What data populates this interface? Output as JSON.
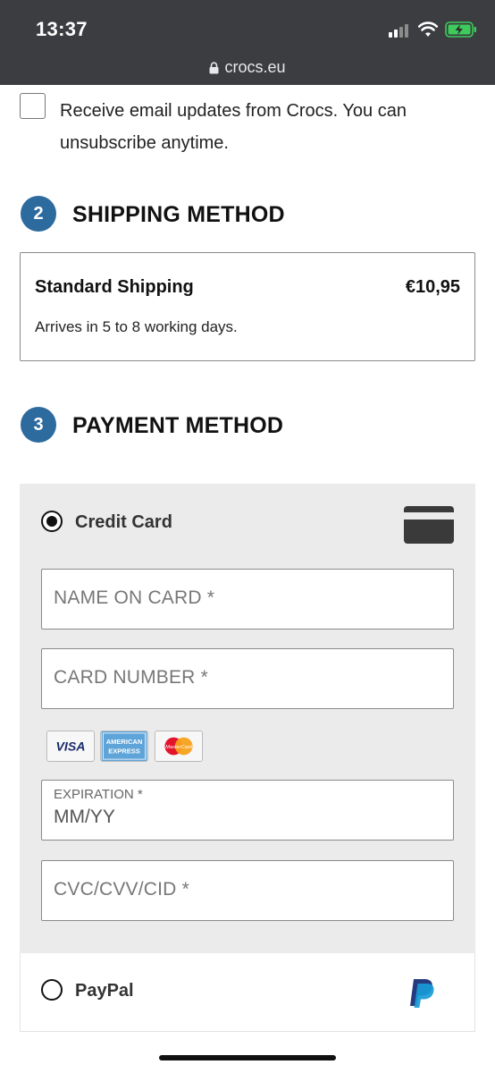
{
  "status_bar": {
    "time": "13:37",
    "icons": [
      "cellular-signal-icon",
      "wifi-icon",
      "battery-charging-icon"
    ],
    "battery_color": "#3ecb5b"
  },
  "browser": {
    "url": "crocs.eu",
    "icon": "lock-icon"
  },
  "newsletter": {
    "label": "Receive email updates from Crocs. You can unsubscribe anytime.",
    "checked": false
  },
  "shipping": {
    "step": "2",
    "title": "SHIPPING METHOD",
    "option": {
      "name": "Standard Shipping",
      "price": "€10,95",
      "eta": "Arrives in 5 to 8 working days."
    }
  },
  "payment": {
    "step": "3",
    "title": "PAYMENT METHOD",
    "credit_card": {
      "label": "Credit Card",
      "selected": true,
      "icon": "credit-card-icon",
      "name_placeholder": "NAME ON CARD *",
      "number_placeholder": "CARD NUMBER *",
      "expiration_label": "EXPIRATION *",
      "expiration_placeholder": "MM/YY",
      "cvc_placeholder": "CVC/CVV/CID *",
      "accepted_cards": [
        "visa-logo",
        "american-express-logo",
        "mastercard-logo"
      ],
      "visa_text": "VISA",
      "amex_text_1": "AMERICAN",
      "amex_text_2": "EXPRESS",
      "mastercard_text": "MasterCard"
    },
    "paypal": {
      "label": "PayPal",
      "selected": false,
      "icon": "paypal-icon"
    }
  },
  "colors": {
    "accent": "#2d6a9e",
    "panel_bg": "#ebebeb",
    "status_bar_bg": "#3b3d40"
  }
}
